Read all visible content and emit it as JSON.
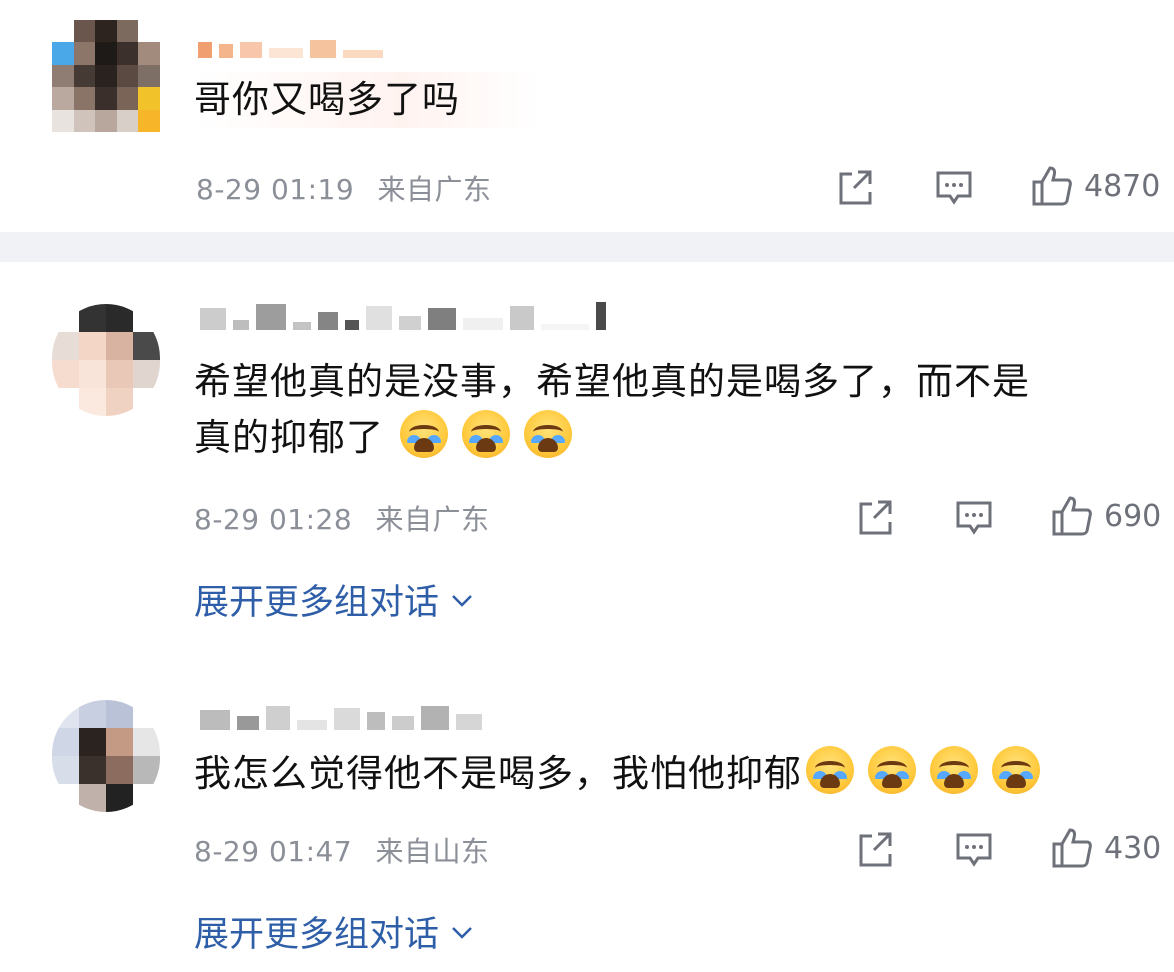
{
  "comments": [
    {
      "text": "哥你又喝多了吗",
      "time": "8-29 01:19",
      "location": "来自广东",
      "likes": "4870",
      "emoji_count": 0
    },
    {
      "text": "希望他真的是没事，希望他真的是喝多了，而不是",
      "text_line2": "真的抑郁了",
      "emoji": "crying-face",
      "emoji_count": 3,
      "time": "8-29 01:28",
      "location": "来自广东",
      "likes": "690",
      "expand_label": "展开更多组对话"
    },
    {
      "text": "我怎么觉得他不是喝多，我怕他抑郁",
      "emoji": "crying-face",
      "emoji_count": 4,
      "time": "8-29 01:47",
      "location": "来自山东",
      "likes": "430",
      "expand_label": "展开更多组对话"
    }
  ],
  "colors": {
    "text": "#111111",
    "meta": "#8b8f98",
    "link": "#2f5ea8",
    "icon": "#6e7179",
    "divider": "#f1f2f5"
  },
  "icons": [
    "share-icon",
    "comment-icon",
    "like-icon",
    "chevron-down-icon",
    "crying-face-emoji"
  ]
}
